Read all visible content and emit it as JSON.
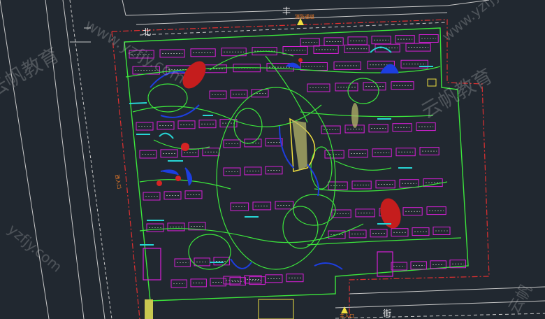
{
  "labels": {
    "north_char": "北",
    "road_top_char": "丰",
    "road_bottom_char": "街",
    "fire_lane": "消防通道",
    "main_entrance": "主入口",
    "west_entrance": "西入口"
  },
  "watermarks": {
    "url_text": "www.yzfjy.com",
    "url_short": "yzfjy.com",
    "brand_text": "云帆教育",
    "brand_text_2": "云帆教育",
    "corner_text": "云帆"
  },
  "colors": {
    "background": "#212830",
    "building": "#d61fd6",
    "road": "#3ce63c",
    "boundary": "#e23030",
    "water": "#1d3ee0",
    "plaza": "#f0e040",
    "accent_cyan": "#27d6d6",
    "white_line": "#c8c8c8"
  }
}
